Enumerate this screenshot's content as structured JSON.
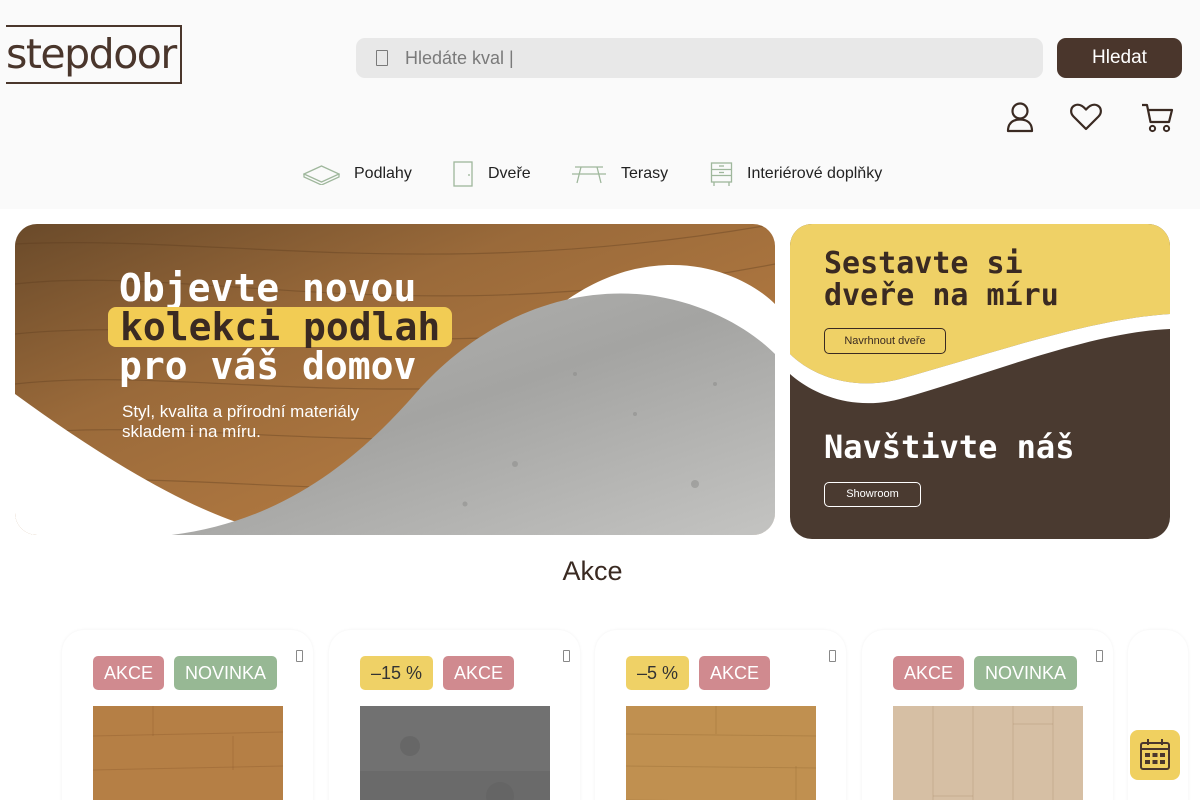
{
  "brand": {
    "logo_text": "stepdoor"
  },
  "header": {
    "search": {
      "placeholder": "Hledáte kval |",
      "value": "",
      "icon": "search-icon"
    },
    "search_button": "Hledat",
    "icons": [
      "user-icon",
      "heart-icon",
      "cart-icon"
    ]
  },
  "nav": {
    "items": [
      {
        "label": "Podlahy",
        "icon": "floor-icon"
      },
      {
        "label": "Dveře",
        "icon": "door-icon"
      },
      {
        "label": "Terasy",
        "icon": "terrace-icon"
      },
      {
        "label": "Interiérové doplňky",
        "icon": "cabinet-icon"
      }
    ]
  },
  "hero": {
    "line1": "Objevte novou",
    "line2": "kolekci podlah",
    "line3": "pro váš domov",
    "subtitle_line1": "Styl, kvalita a přírodní materiály",
    "subtitle_line2": "skladem i na míru."
  },
  "side_banner": {
    "top_title_line1": "Sestavte si",
    "top_title_line2": "dveře na míru",
    "top_button": "Navrhnout dveře",
    "bottom_title": "Navštivte náš",
    "bottom_button": "Showroom"
  },
  "sale_section": {
    "title": "Akce",
    "cards": [
      {
        "badges": [
          "AKCE",
          "NOVINKA"
        ]
      },
      {
        "badges": [
          "–15 %",
          "AKCE"
        ]
      },
      {
        "badges": [
          "–5 %",
          "AKCE"
        ]
      },
      {
        "badges": [
          "AKCE",
          "NOVINKA"
        ]
      }
    ]
  },
  "colors": {
    "brand_brown": "#4a362c",
    "yellow": "#efd166",
    "akce_badge": "#d08a8f",
    "novinka_badge": "#97b894",
    "nav_icon_green": "#9fb79c"
  }
}
